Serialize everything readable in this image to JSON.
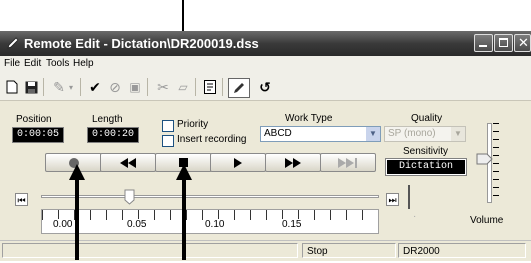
{
  "window": {
    "title": "Remote Edit - Dictation\\DR200019.dss",
    "icon": "pen-icon",
    "buttons": [
      "minimize",
      "maximize",
      "close"
    ]
  },
  "menu": [
    "File",
    "Edit",
    "Tools",
    "Help"
  ],
  "toolbar_icons": [
    "new-icon",
    "save-icon",
    "dictate-icon",
    "dropdown-icon",
    "check-icon",
    "cancel-icon",
    "print-icon",
    "cut-icon",
    "insert-icon",
    "properties-icon",
    "edit-icon",
    "undo-icon"
  ],
  "position": {
    "label": "Position",
    "value": "0:00:05"
  },
  "length": {
    "label": "Length",
    "value": "0:00:20"
  },
  "priority": {
    "label": "Priority"
  },
  "insert_recording": {
    "label": "Insert recording"
  },
  "work_type": {
    "label": "Work Type",
    "value": "ABCD"
  },
  "quality": {
    "label": "Quality",
    "value": "SP (mono)"
  },
  "sensitivity": {
    "label": "Sensitivity",
    "value": "Dictation"
  },
  "transport": [
    "record",
    "rewind",
    "stop",
    "play",
    "fast-forward",
    "end"
  ],
  "timeline": {
    "ticks": [
      "0.00",
      "0.05",
      "0.10",
      "0.15"
    ],
    "position": 0.25
  },
  "volume": {
    "label": "Volume",
    "level": 0.55
  },
  "status": {
    "state": "Stop",
    "device": "DR2000"
  }
}
